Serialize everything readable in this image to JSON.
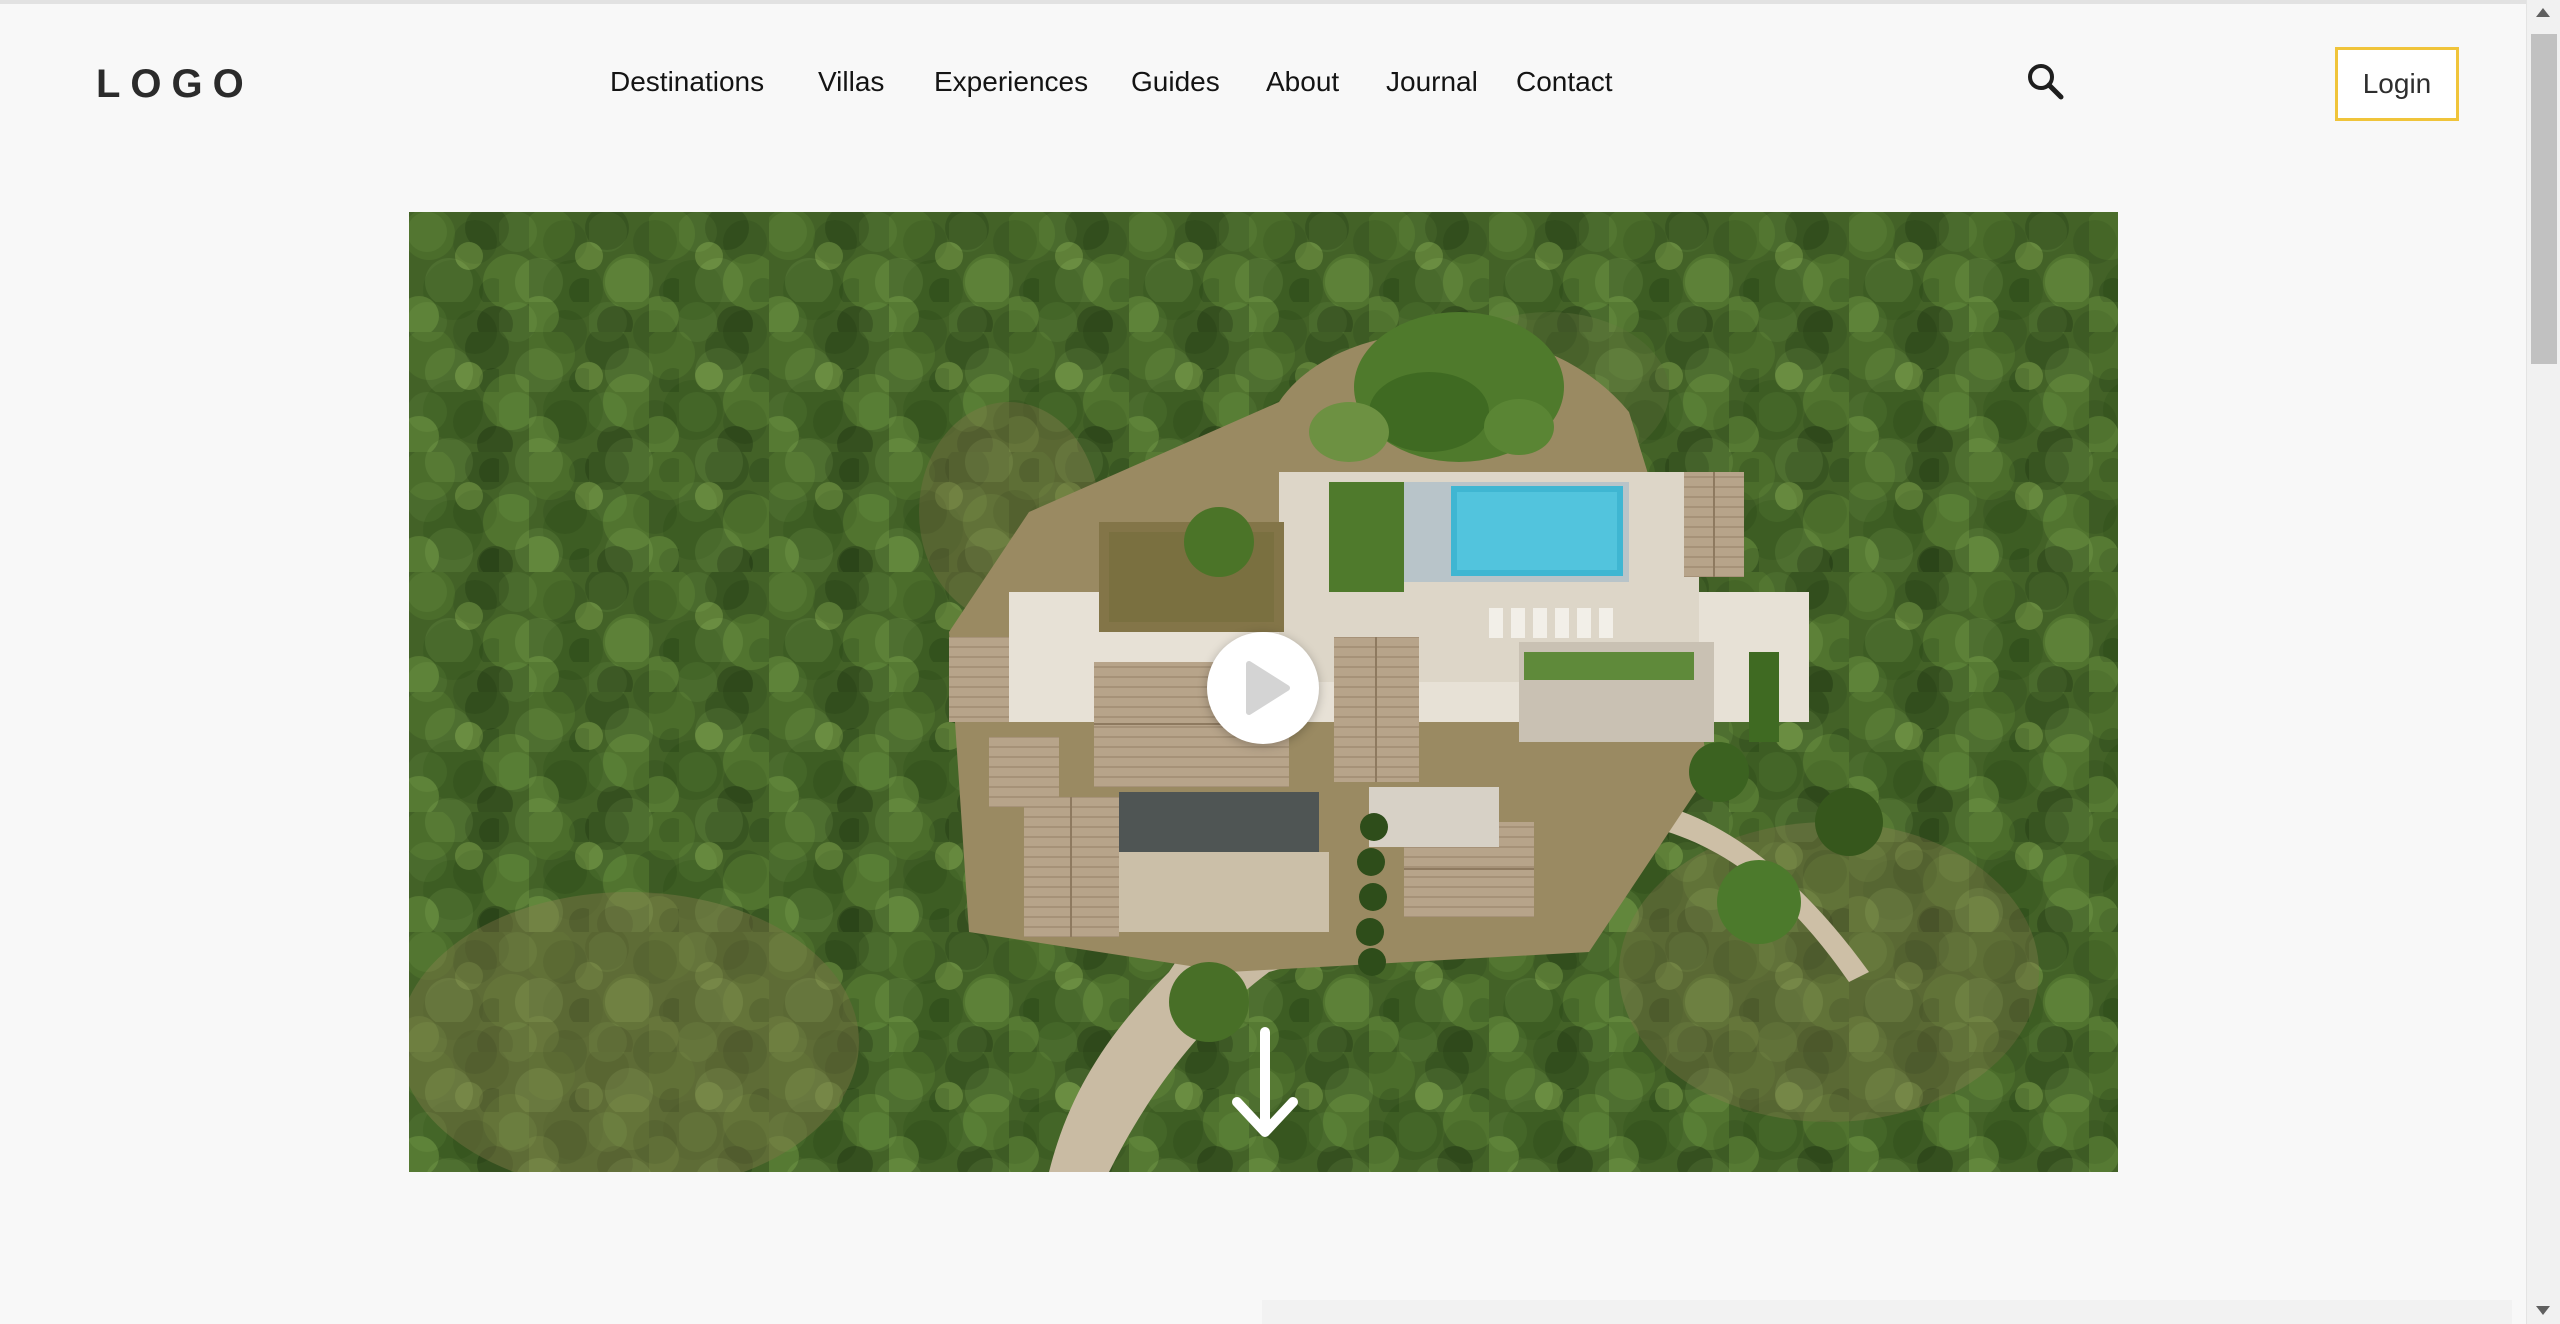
{
  "header": {
    "logo": "LOGO",
    "login_label": "Login",
    "search_icon": "search-icon"
  },
  "nav": {
    "items": [
      {
        "label": "Destinations"
      },
      {
        "label": "Villas"
      },
      {
        "label": "Experiences"
      },
      {
        "label": "Guides"
      },
      {
        "label": "About"
      },
      {
        "label": "Journal"
      },
      {
        "label": "Contact"
      }
    ]
  },
  "hero": {
    "media": "aerial-villa-video",
    "play_icon": "play-icon",
    "scroll_icon": "arrow-down-icon"
  },
  "colors": {
    "page_background": "#f8f8f8",
    "login_border": "#f0c43a",
    "text": "#141414"
  }
}
